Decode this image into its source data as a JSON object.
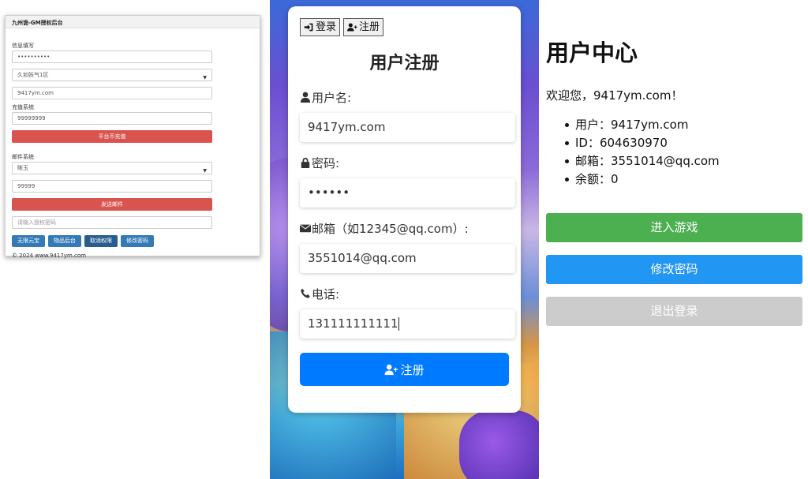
{
  "gm": {
    "title": "九州诡-GM授权后台",
    "info_label": "信息填写",
    "password_value": "••••••••••",
    "server_value": "久如妖气1区",
    "account_value": "9417ym.com",
    "recharge_label": "充值系统",
    "recharge_value": "99999999",
    "recharge_button": "平台币充值",
    "mail_label": "邮件系统",
    "mail_item_value": "晰玉",
    "mail_qty_value": "99999",
    "send_mail_button": "发送邮件",
    "auth_placeholder": "请输入授权密码",
    "buttons": [
      "无限元宝",
      "物品后台",
      "取消权限",
      "修改密码"
    ],
    "footer": "© 2024 www.9417ym.com"
  },
  "register": {
    "tab_login": "登录",
    "tab_register": "注册",
    "title": "用户注册",
    "username_label": "用户名:",
    "username_value": "9417ym.com",
    "password_label": "密码:",
    "password_value": "••••••",
    "email_label": "邮箱（如12345@qq.com）:",
    "email_value": "3551014@qq.com",
    "phone_label": "电话:",
    "phone_value": "131111111111",
    "submit_label": "注册"
  },
  "user_center": {
    "title": "用户中心",
    "welcome": "欢迎您，9417ym.com！",
    "items": [
      "用户：9417ym.com",
      "ID：604630970",
      "邮箱：3551014@qq.com",
      "余额：0"
    ],
    "enter_game": "进入游戏",
    "change_password": "修改密码",
    "logout": "退出登录"
  },
  "colors": {
    "danger": "#d9534f",
    "primary": "#337ab7",
    "register_blue": "#007bff",
    "green": "#4caf50",
    "blue": "#2196f3",
    "gray": "#cccccc"
  }
}
